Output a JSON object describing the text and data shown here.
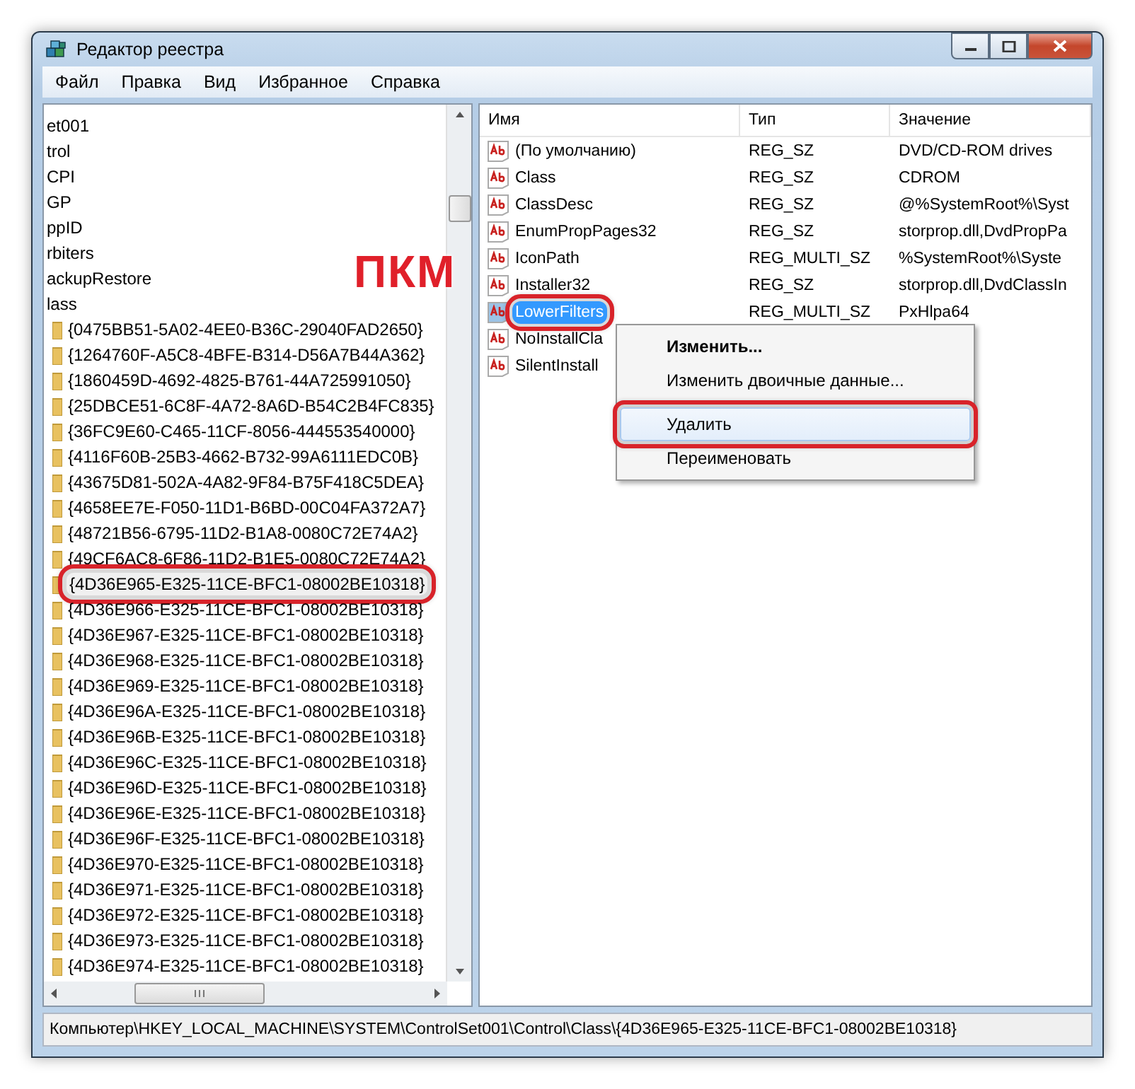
{
  "window": {
    "title": "Редактор реестра"
  },
  "menu": [
    "Файл",
    "Правка",
    "Вид",
    "Избранное",
    "Справка"
  ],
  "tree": [
    {
      "label": "et001",
      "kind": "plain",
      "selected": false,
      "circled": false
    },
    {
      "label": "trol",
      "kind": "plain",
      "selected": false,
      "circled": false
    },
    {
      "label": "CPI",
      "kind": "plain",
      "selected": false,
      "circled": false
    },
    {
      "label": "GP",
      "kind": "plain",
      "selected": false,
      "circled": false
    },
    {
      "label": "ppID",
      "kind": "plain",
      "selected": false,
      "circled": false
    },
    {
      "label": "rbiters",
      "kind": "plain",
      "selected": false,
      "circled": false
    },
    {
      "label": "ackupRestore",
      "kind": "plain",
      "selected": false,
      "circled": false
    },
    {
      "label": "lass",
      "kind": "plain",
      "selected": false,
      "circled": false
    },
    {
      "label": "{0475BB51-5A02-4EE0-B36C-29040FAD2650}",
      "kind": "folder",
      "selected": false,
      "circled": false
    },
    {
      "label": "{1264760F-A5C8-4BFE-B314-D56A7B44A362}",
      "kind": "folder",
      "selected": false,
      "circled": false
    },
    {
      "label": "{1860459D-4692-4825-B761-44A725991050}",
      "kind": "folder",
      "selected": false,
      "circled": false
    },
    {
      "label": "{25DBCE51-6C8F-4A72-8A6D-B54C2B4FC835}",
      "kind": "folder",
      "selected": false,
      "circled": false
    },
    {
      "label": "{36FC9E60-C465-11CF-8056-444553540000}",
      "kind": "folder",
      "selected": false,
      "circled": false
    },
    {
      "label": "{4116F60B-25B3-4662-B732-99A6111EDC0B}",
      "kind": "folder",
      "selected": false,
      "circled": false
    },
    {
      "label": "{43675D81-502A-4A82-9F84-B75F418C5DEA}",
      "kind": "folder",
      "selected": false,
      "circled": false
    },
    {
      "label": "{4658EE7E-F050-11D1-B6BD-00C04FA372A7}",
      "kind": "folder",
      "selected": false,
      "circled": false
    },
    {
      "label": "{48721B56-6795-11D2-B1A8-0080C72E74A2}",
      "kind": "folder",
      "selected": false,
      "circled": false
    },
    {
      "label": "{49CF6AC8-6F86-11D2-B1E5-0080C72E74A2}",
      "kind": "folder",
      "selected": false,
      "circled": false
    },
    {
      "label": "{4D36E965-E325-11CE-BFC1-08002BE10318}",
      "kind": "folder",
      "selected": true,
      "circled": true
    },
    {
      "label": "{4D36E966-E325-11CE-BFC1-08002BE10318}",
      "kind": "folder",
      "selected": false,
      "circled": false
    },
    {
      "label": "{4D36E967-E325-11CE-BFC1-08002BE10318}",
      "kind": "folder",
      "selected": false,
      "circled": false
    },
    {
      "label": "{4D36E968-E325-11CE-BFC1-08002BE10318}",
      "kind": "folder",
      "selected": false,
      "circled": false
    },
    {
      "label": "{4D36E969-E325-11CE-BFC1-08002BE10318}",
      "kind": "folder",
      "selected": false,
      "circled": false
    },
    {
      "label": "{4D36E96A-E325-11CE-BFC1-08002BE10318}",
      "kind": "folder",
      "selected": false,
      "circled": false
    },
    {
      "label": "{4D36E96B-E325-11CE-BFC1-08002BE10318}",
      "kind": "folder",
      "selected": false,
      "circled": false
    },
    {
      "label": "{4D36E96C-E325-11CE-BFC1-08002BE10318}",
      "kind": "folder",
      "selected": false,
      "circled": false
    },
    {
      "label": "{4D36E96D-E325-11CE-BFC1-08002BE10318}",
      "kind": "folder",
      "selected": false,
      "circled": false
    },
    {
      "label": "{4D36E96E-E325-11CE-BFC1-08002BE10318}",
      "kind": "folder",
      "selected": false,
      "circled": false
    },
    {
      "label": "{4D36E96F-E325-11CE-BFC1-08002BE10318}",
      "kind": "folder",
      "selected": false,
      "circled": false
    },
    {
      "label": "{4D36E970-E325-11CE-BFC1-08002BE10318}",
      "kind": "folder",
      "selected": false,
      "circled": false
    },
    {
      "label": "{4D36E971-E325-11CE-BFC1-08002BE10318}",
      "kind": "folder",
      "selected": false,
      "circled": false
    },
    {
      "label": "{4D36E972-E325-11CE-BFC1-08002BE10318}",
      "kind": "folder",
      "selected": false,
      "circled": false
    },
    {
      "label": "{4D36E973-E325-11CE-BFC1-08002BE10318}",
      "kind": "folder",
      "selected": false,
      "circled": false
    },
    {
      "label": "{4D36E974-E325-11CE-BFC1-08002BE10318}",
      "kind": "folder",
      "selected": false,
      "circled": false
    }
  ],
  "table": {
    "columns": [
      "Имя",
      "Тип",
      "Значение"
    ],
    "rows": [
      {
        "name": "(По умолчанию)",
        "type": "REG_SZ",
        "value": "DVD/CD-ROM drives",
        "selected": false,
        "circled": false
      },
      {
        "name": "Class",
        "type": "REG_SZ",
        "value": "CDROM",
        "selected": false,
        "circled": false
      },
      {
        "name": "ClassDesc",
        "type": "REG_SZ",
        "value": "@%SystemRoot%\\Syst",
        "selected": false,
        "circled": false
      },
      {
        "name": "EnumPropPages32",
        "type": "REG_SZ",
        "value": "storprop.dll,DvdPropPa",
        "selected": false,
        "circled": false
      },
      {
        "name": "IconPath",
        "type": "REG_MULTI_SZ",
        "value": "%SystemRoot%\\Syste",
        "selected": false,
        "circled": false
      },
      {
        "name": "Installer32",
        "type": "REG_SZ",
        "value": "storprop.dll,DvdClassIn",
        "selected": false,
        "circled": false
      },
      {
        "name": "LowerFilters",
        "type": "REG_MULTI_SZ",
        "value": "PxHlpa64",
        "selected": true,
        "circled": true
      },
      {
        "name": "NoInstallCla",
        "type": "",
        "value": "",
        "selected": false,
        "circled": false
      },
      {
        "name": "SilentInstall",
        "type": "",
        "value": "",
        "selected": false,
        "circled": false
      }
    ]
  },
  "context_menu": [
    {
      "kind": "item",
      "label": "Изменить...",
      "default": true,
      "highlighted": false,
      "circled": false
    },
    {
      "kind": "item",
      "label": "Изменить двоичные данные...",
      "default": false,
      "highlighted": false,
      "circled": false
    },
    {
      "kind": "separator"
    },
    {
      "kind": "item",
      "label": "Удалить",
      "default": false,
      "highlighted": true,
      "circled": true
    },
    {
      "kind": "item",
      "label": "Переименовать",
      "default": false,
      "highlighted": false,
      "circled": false
    }
  ],
  "annotation": {
    "text": "ПКМ"
  },
  "status_bar": "Компьютер\\HKEY_LOCAL_MACHINE\\SYSTEM\\ControlSet001\\Control\\Class\\{4D36E965-E325-11CE-BFC1-08002BE10318}"
}
